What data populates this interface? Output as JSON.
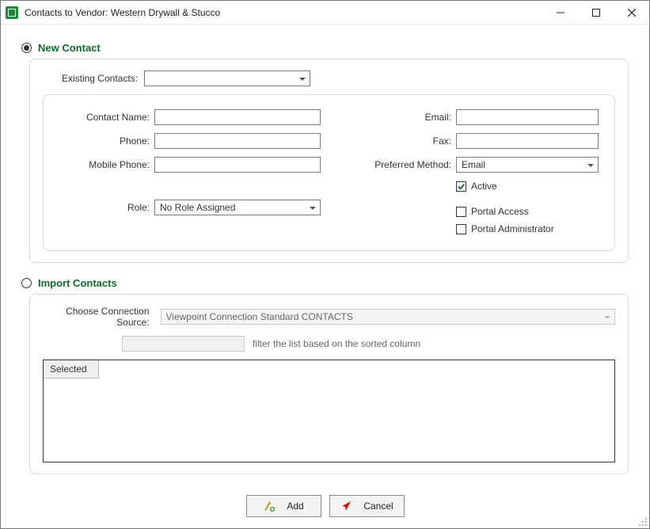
{
  "window": {
    "title": "Contacts to Vendor: Western Drywall & Stucco"
  },
  "sections": {
    "new_contact_label": "New Contact",
    "import_contacts_label": "Import Contacts",
    "selected_mode": "new_contact"
  },
  "new_contact": {
    "existing_contacts_label": "Existing Contacts:",
    "existing_contacts_value": "",
    "fields": {
      "contact_name_label": "Contact Name:",
      "contact_name_value": "",
      "phone_label": "Phone:",
      "phone_value": "",
      "mobile_phone_label": "Mobile Phone:",
      "mobile_phone_value": "",
      "role_label": "Role:",
      "role_value": "No Role Assigned",
      "email_label": "Email:",
      "email_value": "",
      "fax_label": "Fax:",
      "fax_value": "",
      "preferred_method_label": "Preferred Method:",
      "preferred_method_value": "Email"
    },
    "checkboxes": {
      "active_label": "Active",
      "active_checked": true,
      "portal_access_label": "Portal Access",
      "portal_access_checked": false,
      "portal_admin_label": "Portal Administrator",
      "portal_admin_checked": false
    }
  },
  "import": {
    "source_label": "Choose Connection Source:",
    "source_value": "Viewpoint Connection Standard CONTACTS",
    "filter_hint": "filter the list based on the sorted column",
    "grid_columns": [
      "Selected"
    ]
  },
  "footer": {
    "add_label": "Add",
    "cancel_label": "Cancel"
  }
}
